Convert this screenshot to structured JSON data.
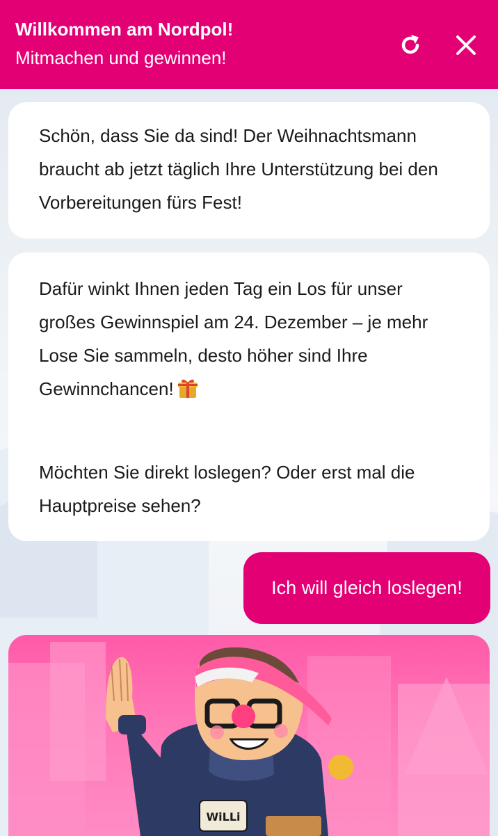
{
  "header": {
    "title": "Willkommen am Nordpol!",
    "subtitle": "Mitmachen und gewinnen!",
    "background_color": "#e20074",
    "refresh_icon": "refresh-icon",
    "close_icon": "close-icon"
  },
  "chat": {
    "messages": [
      {
        "sender": "bot",
        "paragraphs": [
          "Schön, dass Sie da sind! Der Weihnachtsmann braucht ab jetzt täglich Ihre Unterstützung bei den Vorbereitungen fürs Fest!"
        ]
      },
      {
        "sender": "bot",
        "paragraphs": [
          "Dafür winkt Ihnen jeden Tag ein Los für unser großes Gewinnspiel am 24. Dezember – je mehr Lose Sie sammeln, desto höher sind Ihre Gewinnchancen!",
          "Möchten Sie direkt loslegen? Oder erst mal die Hauptpreise sehen?"
        ],
        "trailing_icon": "gift-icon"
      }
    ],
    "user_reply": "Ich will gleich loslegen!",
    "card_image": {
      "icon": "elf-illustration",
      "badge_text": "WiLLi"
    }
  },
  "colors": {
    "accent": "#e20074",
    "bubble": "#ffffff",
    "text": "#1a1a1a"
  }
}
